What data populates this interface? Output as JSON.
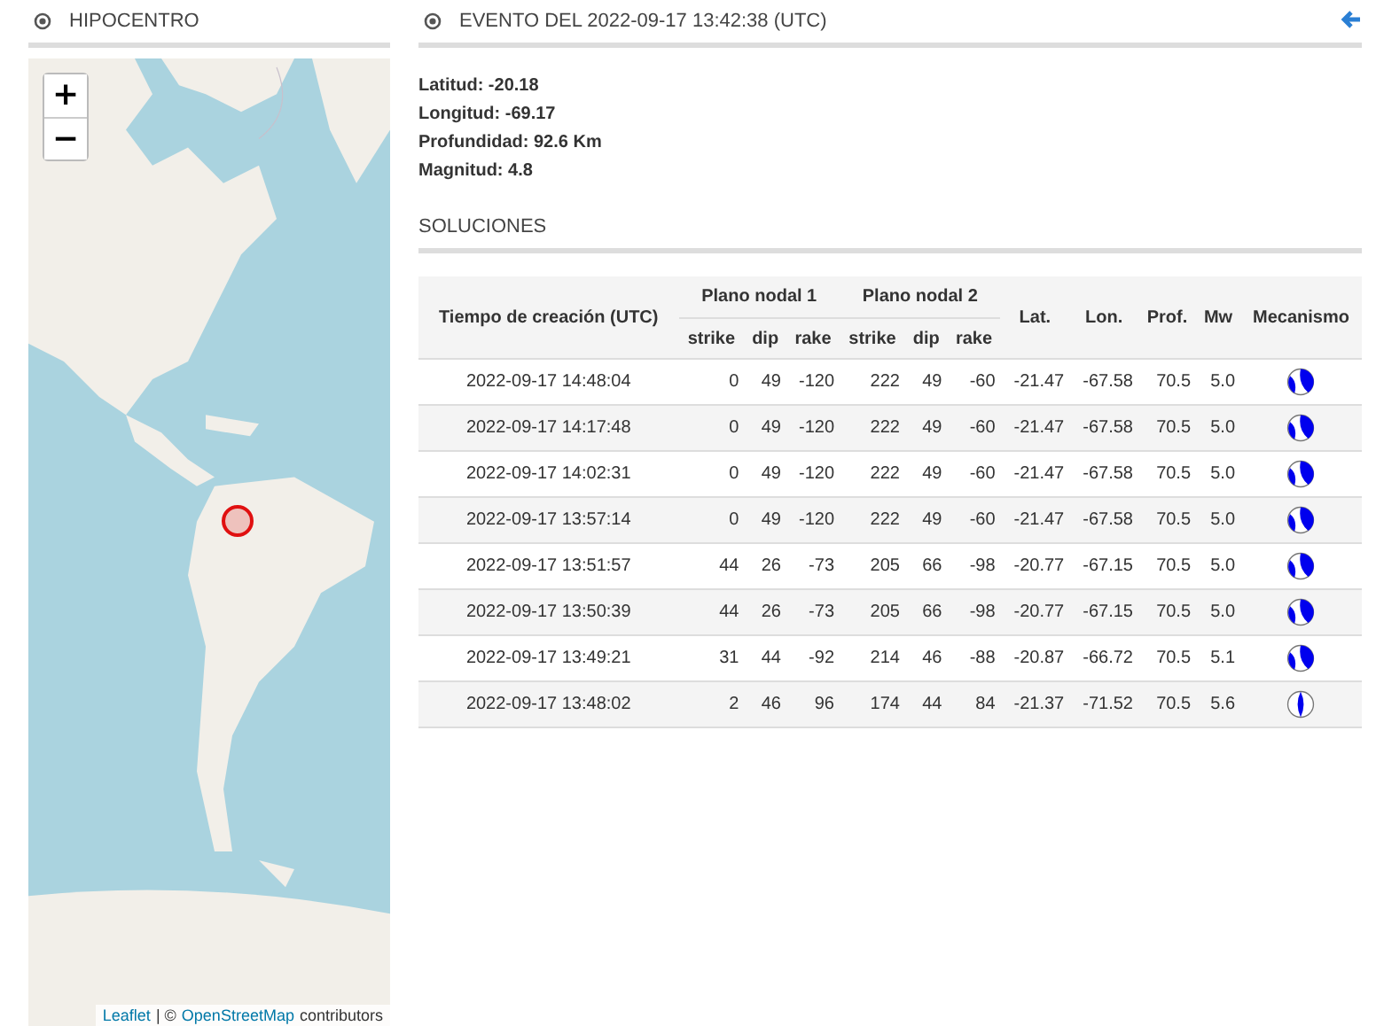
{
  "left_panel": {
    "title": "HIPOCENTRO"
  },
  "map": {
    "kind": "picture",
    "zoom_in": "+",
    "zoom_out": "−",
    "attribution": {
      "leaflet": "Leaflet",
      "separator": "| ©",
      "osm": "OpenStreetMap",
      "suffix": "contributors"
    }
  },
  "event": {
    "title": "EVENTO DEL 2022-09-17 13:42:38 (UTC)",
    "details": [
      {
        "label": "Latitud:",
        "value": "-20.18"
      },
      {
        "label": "Longitud:",
        "value": "-69.17"
      },
      {
        "label": "Profundidad:",
        "value": "92.6 Km"
      },
      {
        "label": "Magnitud:",
        "value": "4.8"
      }
    ]
  },
  "solutions": {
    "title": "SOLUCIONES",
    "headers": {
      "time": "Tiempo de creación (UTC)",
      "plane1": "Plano nodal 1",
      "plane2": "Plano nodal 2",
      "sub": [
        "strike",
        "dip",
        "rake",
        "strike",
        "dip",
        "rake"
      ],
      "lat": "Lat.",
      "lon": "Lon.",
      "depth": "Prof.",
      "mw": "Mw",
      "mechanism": "Mecanismo"
    },
    "rows": [
      {
        "cells": [
          "2022-09-17 14:48:04",
          "0",
          "49",
          "-120",
          "222",
          "49",
          "-60",
          "-21.47",
          "-67.58",
          "70.5",
          "5.0"
        ]
      },
      {
        "cells": [
          "2022-09-17 14:17:48",
          "0",
          "49",
          "-120",
          "222",
          "49",
          "-60",
          "-21.47",
          "-67.58",
          "70.5",
          "5.0"
        ]
      },
      {
        "cells": [
          "2022-09-17 14:02:31",
          "0",
          "49",
          "-120",
          "222",
          "49",
          "-60",
          "-21.47",
          "-67.58",
          "70.5",
          "5.0"
        ]
      },
      {
        "cells": [
          "2022-09-17 13:57:14",
          "0",
          "49",
          "-120",
          "222",
          "49",
          "-60",
          "-21.47",
          "-67.58",
          "70.5",
          "5.0"
        ]
      },
      {
        "cells": [
          "2022-09-17 13:51:57",
          "44",
          "26",
          "-73",
          "205",
          "66",
          "-98",
          "-20.77",
          "-67.15",
          "70.5",
          "5.0"
        ]
      },
      {
        "cells": [
          "2022-09-17 13:50:39",
          "44",
          "26",
          "-73",
          "205",
          "66",
          "-98",
          "-20.77",
          "-67.15",
          "70.5",
          "5.0"
        ]
      },
      {
        "cells": [
          "2022-09-17 13:49:21",
          "31",
          "44",
          "-92",
          "214",
          "46",
          "-88",
          "-20.87",
          "-66.72",
          "70.5",
          "5.1"
        ]
      },
      {
        "cells": [
          "2022-09-17 13:48:02",
          "2",
          "46",
          "96",
          "174",
          "44",
          "84",
          "-21.37",
          "-71.52",
          "70.5",
          "5.6"
        ]
      }
    ]
  }
}
